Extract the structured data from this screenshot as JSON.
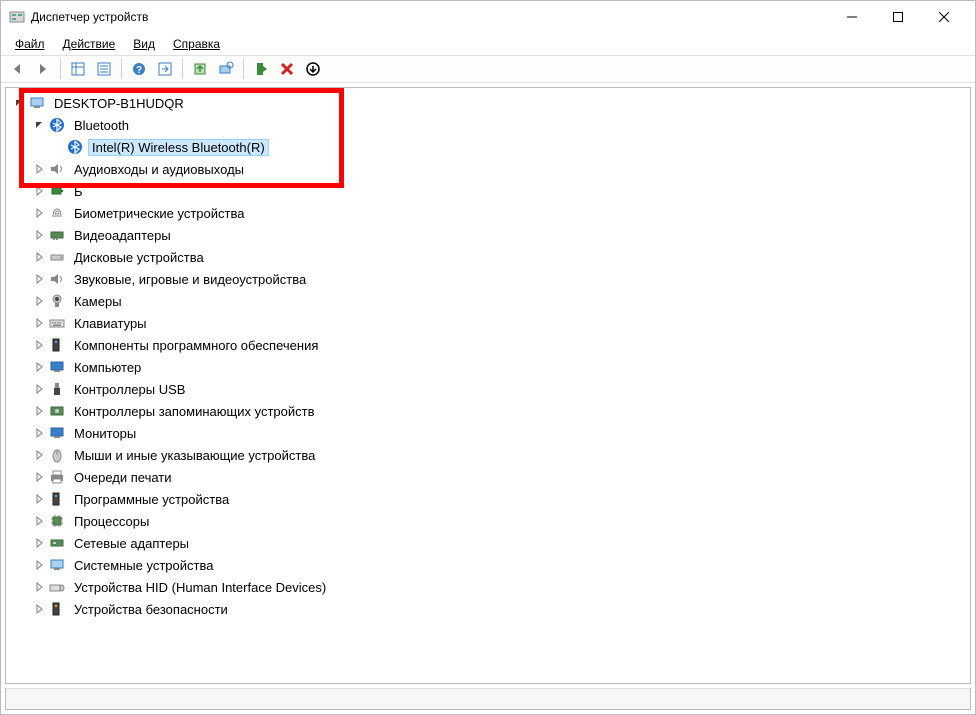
{
  "window": {
    "title": "Диспетчер устройств"
  },
  "menu": {
    "file": "Файл",
    "action": "Действие",
    "view": "Вид",
    "help": "Справка"
  },
  "tree": {
    "root": "DESKTOP-B1HUDQR",
    "bluetooth": {
      "label": "Bluetooth",
      "child": "Intel(R) Wireless Bluetooth(R)"
    },
    "audio": "Аудиовходы и аудиовыходы",
    "partial": "Б",
    "biometric": "Биометрические устройства",
    "display": "Видеоадаптеры",
    "disk": "Дисковые устройства",
    "sound": "Звуковые, игровые и видеоустройства",
    "camera": "Камеры",
    "keyboard": "Клавиатуры",
    "software": "Компоненты программного обеспечения",
    "computer": "Компьютер",
    "usb": "Контроллеры USB",
    "storage": "Контроллеры запоминающих устройств",
    "monitor": "Мониторы",
    "mouse": "Мыши и иные указывающие устройства",
    "printqueue": "Очереди печати",
    "softdev": "Программные устройства",
    "cpu": "Процессоры",
    "network": "Сетевые адаптеры",
    "system": "Системные устройства",
    "hid": "Устройства HID (Human Interface Devices)",
    "security": "Устройства безопасности"
  }
}
